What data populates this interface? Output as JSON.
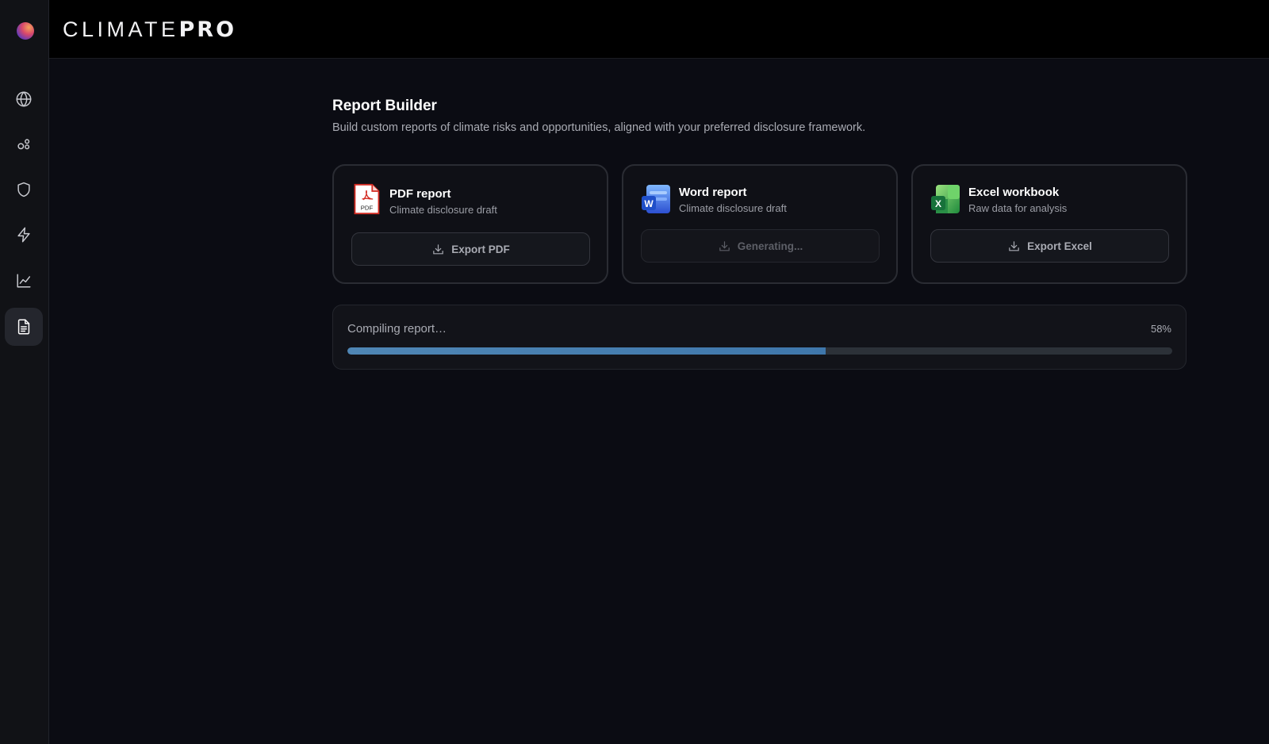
{
  "brand": {
    "light": "CLIMATE",
    "bold": "PRO"
  },
  "sidebar": {
    "items": [
      {
        "icon": "globe-icon",
        "active": false
      },
      {
        "icon": "relationships-icon",
        "active": false
      },
      {
        "icon": "shield-icon",
        "active": false
      },
      {
        "icon": "lightning-icon",
        "active": false
      },
      {
        "icon": "line-chart-icon",
        "active": false
      },
      {
        "icon": "document-icon",
        "active": true
      }
    ]
  },
  "page": {
    "title": "Report Builder",
    "subtitle": "Build custom reports of climate risks and opportunities, aligned with your preferred disclosure framework."
  },
  "cards": [
    {
      "icon": "pdf-file-icon",
      "title": "PDF report",
      "subtitle": "Climate disclosure draft",
      "button": "Export PDF",
      "disabled": false
    },
    {
      "icon": "word-file-icon",
      "title": "Word report",
      "subtitle": "Climate disclosure draft",
      "button": "Generating...",
      "disabled": true
    },
    {
      "icon": "excel-file-icon",
      "title": "Excel workbook",
      "subtitle": "Raw data for analysis",
      "button": "Export Excel",
      "disabled": false
    }
  ],
  "progress": {
    "label": "Compiling report…",
    "percent_text": "58%",
    "value": 0.58
  },
  "colors": {
    "accent": "#4f86b5",
    "pdf_red": "#d42b22",
    "word_blue": "#2f63d8",
    "excel_green": "#2e9a4a"
  }
}
